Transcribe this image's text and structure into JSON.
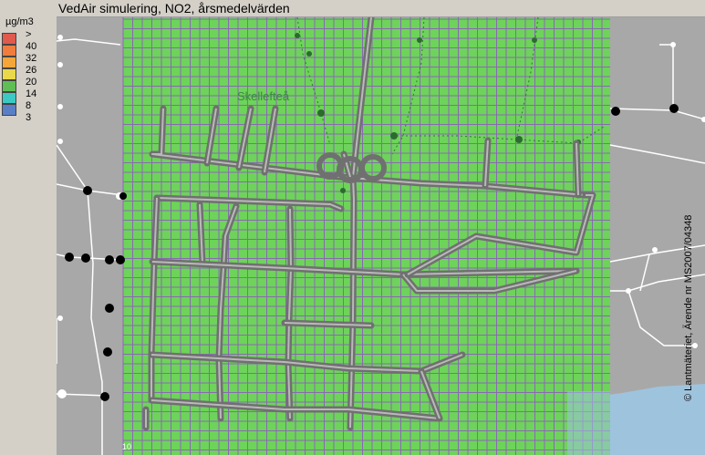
{
  "title": "VedAir simulering, NO2, årsmedelvärden",
  "legend": {
    "unit": "µg/m3",
    "items": [
      {
        "label": ">",
        "color": "#e05a4e"
      },
      {
        "label": "40",
        "color": "#f07c3e"
      },
      {
        "label": "32",
        "color": "#f4a63a"
      },
      {
        "label": "26",
        "color": "#e9d94a"
      },
      {
        "label": "20",
        "color": "#5fbe55"
      },
      {
        "label": "14",
        "color": "#3cc9c4"
      },
      {
        "label": "8",
        "color": "#5a7fc7"
      },
      {
        "label": "3",
        "color": ""
      }
    ]
  },
  "map": {
    "place_label": "Skellefteå",
    "grid_value_label": "10",
    "grid_color": "#6ed35a",
    "outside_color": "#a8a8a8",
    "water_color": "#9ec3dd",
    "road_color": "#808080"
  },
  "copyright": "© Lantmäteriet, Ärende nr MS2007/04348"
}
